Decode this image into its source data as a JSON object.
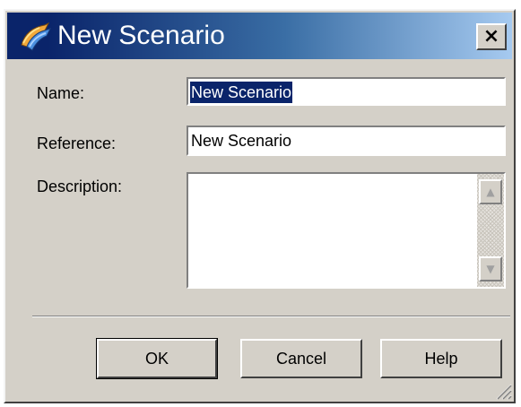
{
  "window": {
    "title": "New Scenario",
    "close_label": "×"
  },
  "form": {
    "name_label": "Name:",
    "name_value": "New Scenario",
    "reference_label": "Reference:",
    "reference_value": "New Scenario",
    "description_label": "Description:",
    "description_value": ""
  },
  "buttons": {
    "ok": "OK",
    "cancel": "Cancel",
    "help": "Help"
  },
  "scrollbar": {
    "up_arrow": "▲",
    "down_arrow": "▼"
  },
  "icons": {
    "app": "scenario-icon",
    "grip": "resize-grip-icon"
  },
  "colors": {
    "title_gradient_start": "#0a246a",
    "title_gradient_end": "#a6caf0",
    "dialog_face": "#d4d0c8",
    "selection": "#0a246a"
  }
}
